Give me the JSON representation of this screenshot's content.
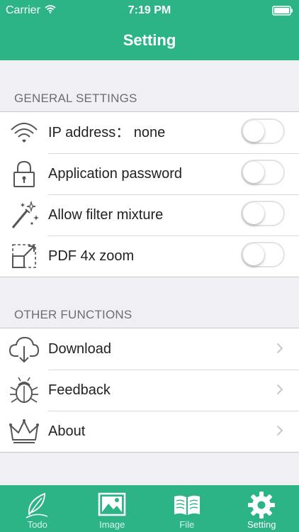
{
  "status_bar": {
    "carrier": "Carrier",
    "time": "7:19 PM"
  },
  "nav": {
    "title": "Setting"
  },
  "general": {
    "header": "GENERAL SETTINGS",
    "items": [
      {
        "label": "IP address： none",
        "icon": "wifi-icon",
        "toggle_on": false
      },
      {
        "label": "Application password",
        "icon": "lock-icon",
        "toggle_on": false
      },
      {
        "label": "Allow filter mixture",
        "icon": "magic-wand-icon",
        "toggle_on": false
      },
      {
        "label": "PDF 4x zoom",
        "icon": "zoom-expand-icon",
        "toggle_on": false
      }
    ]
  },
  "other": {
    "header": "OTHER FUNCTIONS",
    "items": [
      {
        "label": "Download",
        "icon": "cloud-download-icon"
      },
      {
        "label": "Feedback",
        "icon": "bug-icon"
      },
      {
        "label": "About",
        "icon": "crown-icon"
      }
    ]
  },
  "tabbar": {
    "tabs": [
      {
        "label": "Todo",
        "icon": "feather-icon",
        "selected": false
      },
      {
        "label": "Image",
        "icon": "image-icon",
        "selected": false
      },
      {
        "label": "File",
        "icon": "book-icon",
        "selected": false
      },
      {
        "label": "Setting",
        "icon": "gear-icon",
        "selected": true
      }
    ]
  },
  "colors": {
    "accent": "#2db486",
    "background": "#efeff4",
    "section_text": "#6d6d72"
  }
}
